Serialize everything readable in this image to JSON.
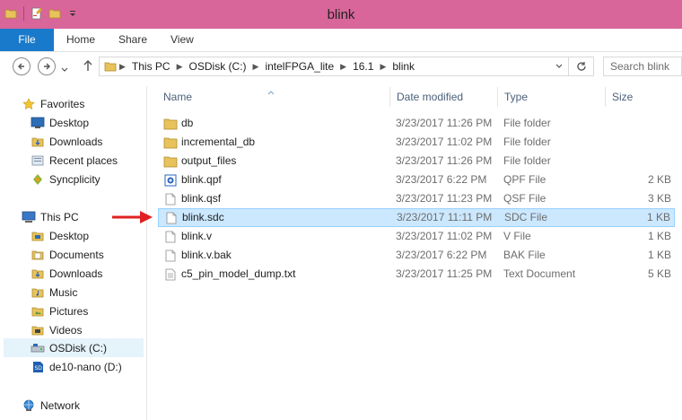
{
  "window": {
    "title": "blink"
  },
  "ribbon": {
    "tabs": [
      {
        "label": "File"
      },
      {
        "label": "Home"
      },
      {
        "label": "Share"
      },
      {
        "label": "View"
      }
    ]
  },
  "address": {
    "crumbs": [
      "This PC",
      "OSDisk (C:)",
      "intelFPGA_lite",
      "16.1",
      "blink"
    ]
  },
  "search": {
    "placeholder": "Search blink"
  },
  "nav": {
    "favorites_label": "Favorites",
    "favorites": [
      "Desktop",
      "Downloads",
      "Recent places",
      "Syncplicity"
    ],
    "thispc_label": "This PC",
    "thispc": [
      "Desktop",
      "Documents",
      "Downloads",
      "Music",
      "Pictures",
      "Videos",
      "OSDisk (C:)",
      "de10-nano (D:)"
    ],
    "network_label": "Network"
  },
  "columns": {
    "name": "Name",
    "date": "Date modified",
    "type": "Type",
    "size": "Size"
  },
  "files": [
    {
      "name": "db",
      "date": "3/23/2017 11:26 PM",
      "type": "File folder",
      "size": "",
      "icon": "folder-icon"
    },
    {
      "name": "incremental_db",
      "date": "3/23/2017 11:02 PM",
      "type": "File folder",
      "size": "",
      "icon": "folder-icon"
    },
    {
      "name": "output_files",
      "date": "3/23/2017 11:26 PM",
      "type": "File folder",
      "size": "",
      "icon": "folder-icon"
    },
    {
      "name": "blink.qpf",
      "date": "3/23/2017 6:22 PM",
      "type": "QPF File",
      "size": "2 KB",
      "icon": "qpf-file-icon"
    },
    {
      "name": "blink.qsf",
      "date": "3/23/2017 11:23 PM",
      "type": "QSF File",
      "size": "3 KB",
      "icon": "file-icon"
    },
    {
      "name": "blink.sdc",
      "date": "3/23/2017 11:11 PM",
      "type": "SDC File",
      "size": "1 KB",
      "icon": "file-icon"
    },
    {
      "name": "blink.v",
      "date": "3/23/2017 11:02 PM",
      "type": "V File",
      "size": "1 KB",
      "icon": "file-icon"
    },
    {
      "name": "blink.v.bak",
      "date": "3/23/2017 6:22 PM",
      "type": "BAK File",
      "size": "1 KB",
      "icon": "file-icon"
    },
    {
      "name": "c5_pin_model_dump.txt",
      "date": "3/23/2017 11:25 PM",
      "type": "Text Document",
      "size": "5 KB",
      "icon": "text-document-icon"
    }
  ],
  "colors": {
    "titlebar": "#d9669a",
    "file_tab": "#1979ca",
    "selection": "#cce8ff",
    "arrow": "#e02020"
  }
}
